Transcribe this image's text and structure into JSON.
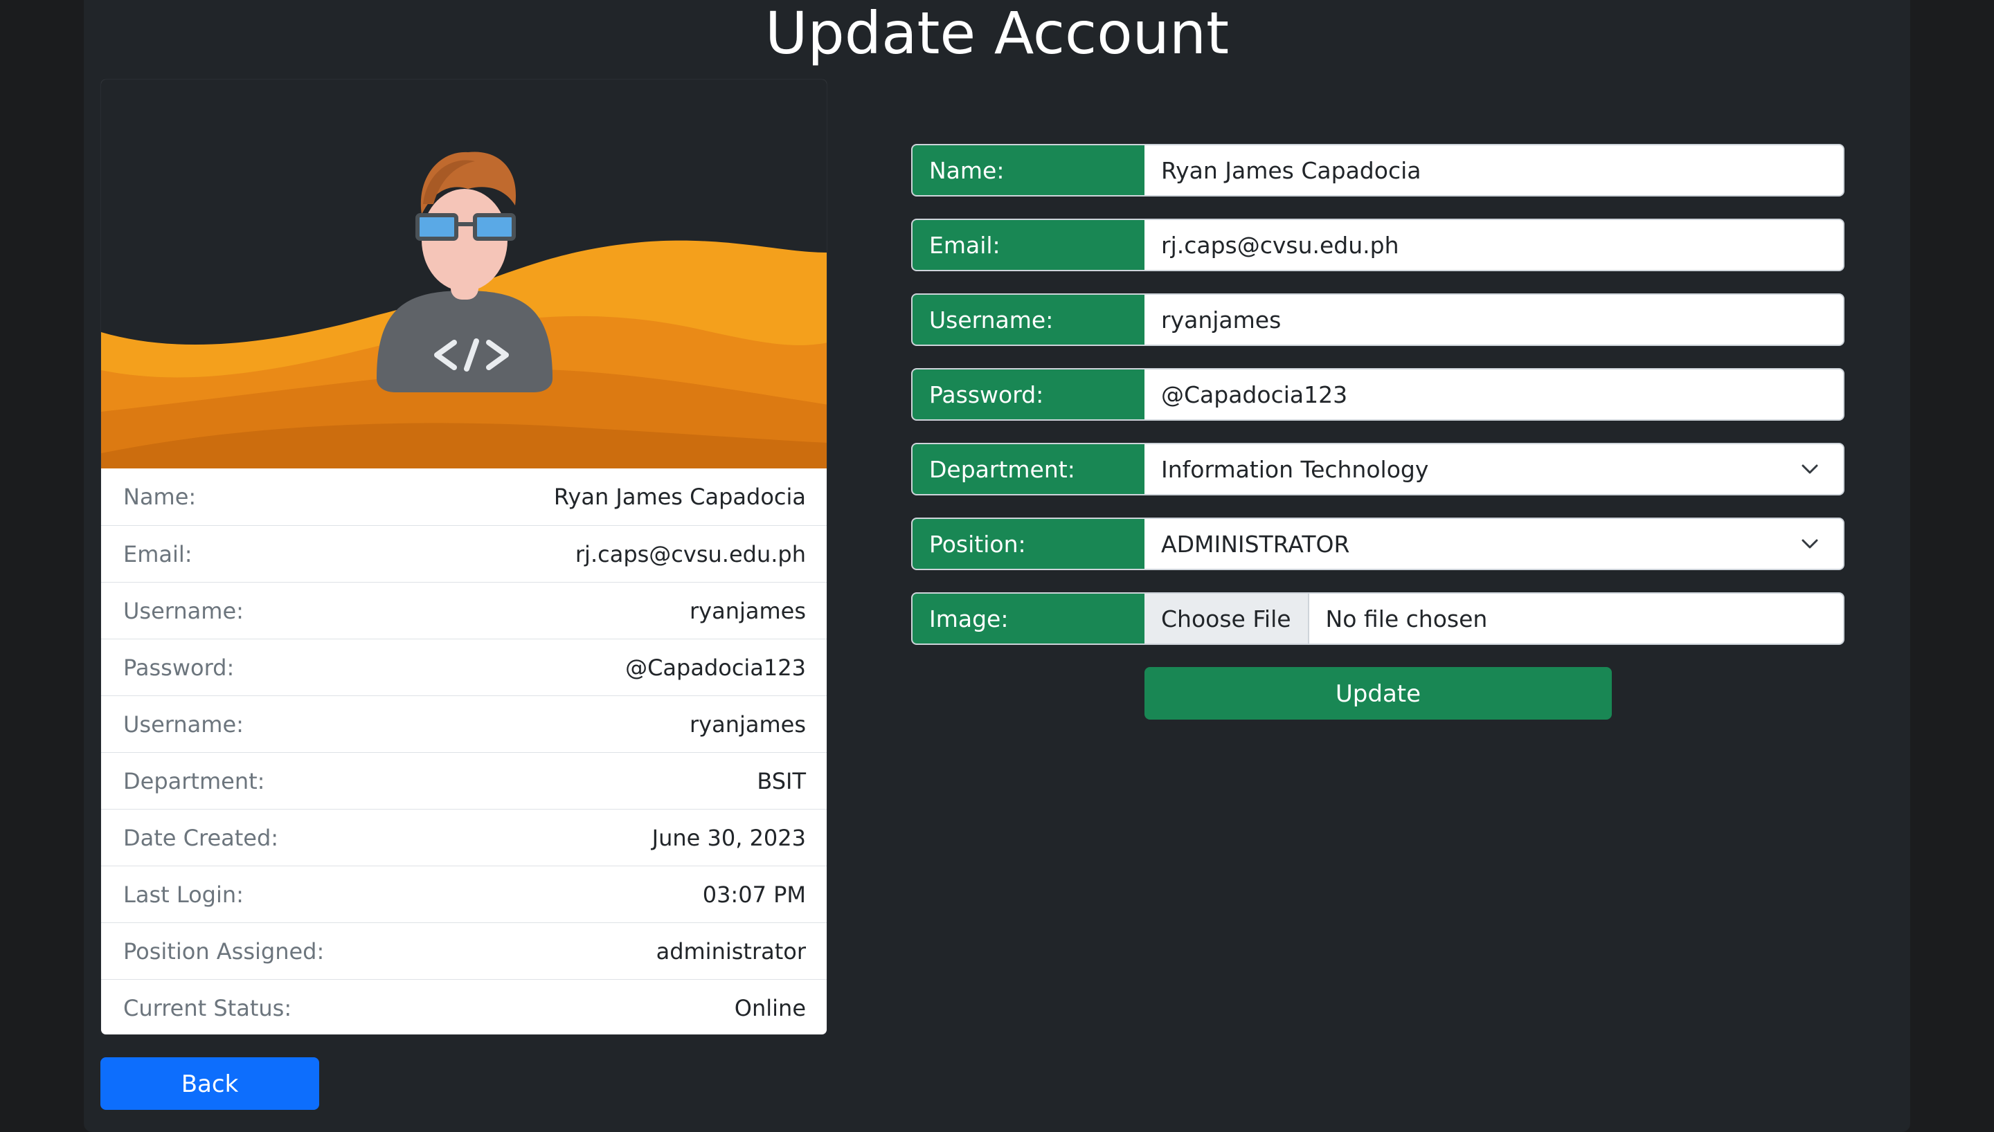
{
  "page": {
    "title": "Update Account"
  },
  "profile": {
    "rows": [
      {
        "label": "Name:",
        "value": "Ryan James Capadocia"
      },
      {
        "label": "Email:",
        "value": "rj.caps@cvsu.edu.ph"
      },
      {
        "label": "Username:",
        "value": "ryanjames"
      },
      {
        "label": "Password:",
        "value": "@Capadocia123"
      },
      {
        "label": "Username:",
        "value": "ryanjames"
      },
      {
        "label": "Department:",
        "value": "BSIT"
      },
      {
        "label": "Date Created:",
        "value": "June 30, 2023"
      },
      {
        "label": "Last Login:",
        "value": "03:07 PM"
      },
      {
        "label": "Position Assigned:",
        "value": "administrator"
      },
      {
        "label": "Current Status:",
        "value": "Online"
      }
    ],
    "back_label": "Back"
  },
  "form": {
    "name": {
      "label": "Name:",
      "value": "Ryan James Capadocia"
    },
    "email": {
      "label": "Email:",
      "value": "rj.caps@cvsu.edu.ph"
    },
    "username": {
      "label": "Username:",
      "value": "ryanjames"
    },
    "password": {
      "label": "Password:",
      "value": "@Capadocia123"
    },
    "department": {
      "label": "Department:",
      "value": "Information Technology"
    },
    "position": {
      "label": "Position:",
      "value": "ADMINISTRATOR"
    },
    "image": {
      "label": "Image:",
      "button": "Choose File",
      "status": "No file chosen"
    },
    "update_label": "Update"
  },
  "colors": {
    "label_green": "#198754",
    "back_blue": "#0d6efd",
    "page_bg": "#212529",
    "wave_orange": "#f0921c"
  },
  "icons": [
    "avatar-developer-illustration",
    "chevron-down-icon"
  ]
}
